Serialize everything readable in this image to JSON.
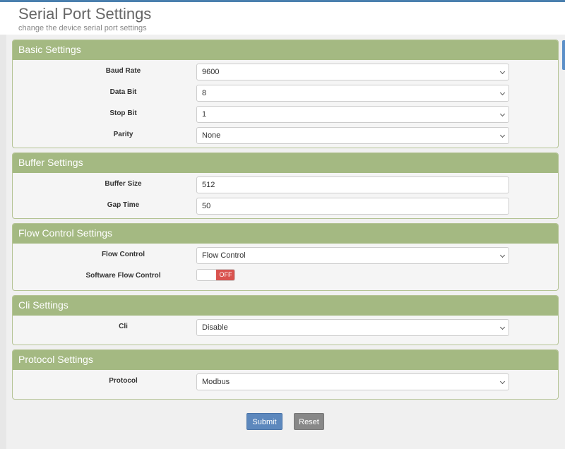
{
  "header": {
    "title": "Serial Port Settings",
    "subtitle": "change the device serial port settings"
  },
  "basic": {
    "title": "Basic Settings",
    "baud_rate_label": "Baud Rate",
    "baud_rate_value": "9600",
    "data_bit_label": "Data Bit",
    "data_bit_value": "8",
    "stop_bit_label": "Stop Bit",
    "stop_bit_value": "1",
    "parity_label": "Parity",
    "parity_value": "None"
  },
  "buffer": {
    "title": "Buffer Settings",
    "buffer_size_label": "Buffer Size",
    "buffer_size_value": "512",
    "gap_time_label": "Gap Time",
    "gap_time_value": "50"
  },
  "flow": {
    "title": "Flow Control Settings",
    "flow_control_label": "Flow Control",
    "flow_control_value": "Flow Control",
    "software_flow_label": "Software Flow Control",
    "software_flow_state": "OFF"
  },
  "cli": {
    "title": "Cli Settings",
    "cli_label": "Cli",
    "cli_value": "Disable"
  },
  "protocol": {
    "title": "Protocol Settings",
    "protocol_label": "Protocol",
    "protocol_value": "Modbus"
  },
  "actions": {
    "submit_label": "Submit",
    "reset_label": "Reset"
  },
  "colors": {
    "panel_header": "#a4b982",
    "toggle_off": "#d9534f",
    "submit": "#5d88bd",
    "reset": "#888888"
  }
}
